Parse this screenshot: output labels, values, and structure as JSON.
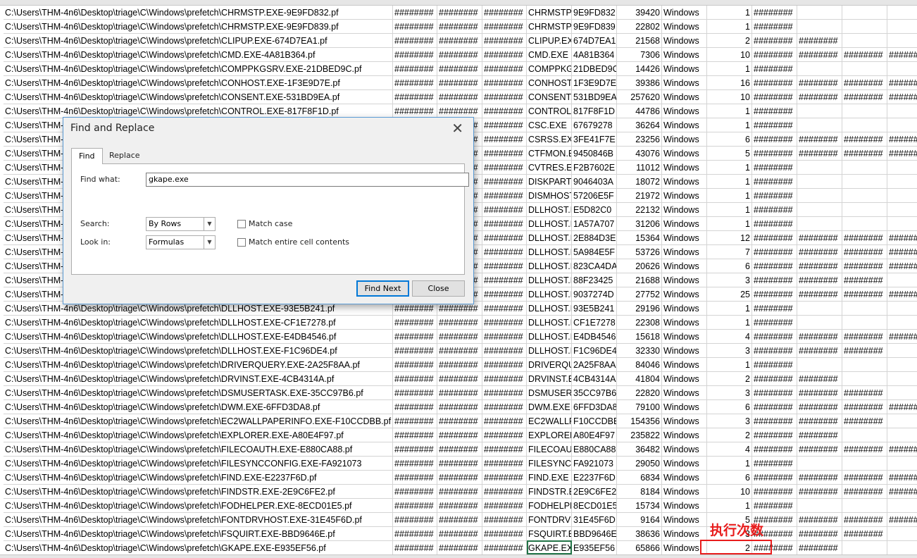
{
  "spreadsheet": {
    "fill": "########",
    "rows": [
      {
        "path": "C:\\Users\\THM-4n6\\Desktop\\triage\\C\\Windows\\prefetch\\CHRMSTP.EXE-9E9FD832.pf",
        "name": "CHRMSTP.",
        "hash": "9E9FD832",
        "size": "39420",
        "os": "Windows",
        "count": "1",
        "extra": 1
      },
      {
        "path": "C:\\Users\\THM-4n6\\Desktop\\triage\\C\\Windows\\prefetch\\CHRMSTP.EXE-9E9FD839.pf",
        "name": "CHRMSTP.",
        "hash": "9E9FD839",
        "size": "22802",
        "os": "Windows",
        "count": "1",
        "extra": 1
      },
      {
        "path": "C:\\Users\\THM-4n6\\Desktop\\triage\\C\\Windows\\prefetch\\CLIPUP.EXE-674D7EA1.pf",
        "name": "CLIPUP.EX",
        "hash": "674D7EA1",
        "size": "21568",
        "os": "Windows",
        "count": "2",
        "extra": 2
      },
      {
        "path": "C:\\Users\\THM-4n6\\Desktop\\triage\\C\\Windows\\prefetch\\CMD.EXE-4A81B364.pf",
        "name": "CMD.EXE",
        "hash": "4A81B364",
        "size": "7306",
        "os": "Windows",
        "count": "10",
        "extra": 4
      },
      {
        "path": "C:\\Users\\THM-4n6\\Desktop\\triage\\C\\Windows\\prefetch\\COMPPKGSRV.EXE-21DBED9C.pf",
        "name": "COMPPKG",
        "hash": "21DBED9C",
        "size": "14426",
        "os": "Windows",
        "count": "1",
        "extra": 1
      },
      {
        "path": "C:\\Users\\THM-4n6\\Desktop\\triage\\C\\Windows\\prefetch\\CONHOST.EXE-1F3E9D7E.pf",
        "name": "CONHOST.",
        "hash": "1F3E9D7E",
        "size": "39386",
        "os": "Windows",
        "count": "16",
        "extra": 4
      },
      {
        "path": "C:\\Users\\THM-4n6\\Desktop\\triage\\C\\Windows\\prefetch\\CONSENT.EXE-531BD9EA.pf",
        "name": "CONSENT.",
        "hash": "531BD9EA",
        "size": "257620",
        "os": "Windows",
        "count": "10",
        "extra": 4
      },
      {
        "path": "C:\\Users\\THM-4n6\\Desktop\\triage\\C\\Windows\\prefetch\\CONTROL.EXE-817F8F1D.pf",
        "name": "CONTROL.",
        "hash": "817F8F1D",
        "size": "44786",
        "os": "Windows",
        "count": "1",
        "extra": 1
      },
      {
        "path": "C:\\Users\\THM-4n6\\Desktop\\triage\\C\\Windows\\prefetch\\CSC.EXE-67679278.pf",
        "name": "CSC.EXE",
        "hash": "67679278",
        "size": "36264",
        "os": "Windows",
        "count": "1",
        "extra": 1
      },
      {
        "path": "C:\\Users\\THM-4n6\\Desktop\\triage\\C\\Windows\\prefetch\\CSRSS.EXE-3FE41F7E.pf",
        "name": "CSRSS.EXE",
        "hash": "3FE41F7E",
        "size": "23256",
        "os": "Windows",
        "count": "6",
        "extra": 4
      },
      {
        "path": "C:\\Users\\THM-4n6\\Desktop\\triage\\C\\Windows\\prefetch\\CTFMON.EXE-9450846B.pf",
        "name": "CTFMON.E",
        "hash": "9450846B",
        "size": "43076",
        "os": "Windows",
        "count": "5",
        "extra": 4
      },
      {
        "path": "C:\\Users\\THM-4n6\\Desktop\\triage\\C\\Windows\\prefetch\\CVTRES.EXE-F2B7602E.pf",
        "name": "CVTRES.EX",
        "hash": "F2B7602E",
        "size": "11012",
        "os": "Windows",
        "count": "1",
        "extra": 1
      },
      {
        "path": "C:\\Users\\THM-4n6\\Desktop\\triage\\C\\Windows\\prefetch\\DISKPART.EXE-9046403A.pf",
        "name": "DISKPART",
        "hash": "9046403A",
        "size": "18072",
        "os": "Windows",
        "count": "1",
        "extra": 1
      },
      {
        "path": "C:\\Users\\THM-4n6\\Desktop\\triage\\C\\Windows\\prefetch\\DISMHOST.EXE-57206E5F.pf",
        "name": "DISMHOST",
        "hash": "57206E5F",
        "size": "21972",
        "os": "Windows",
        "count": "1",
        "extra": 1
      },
      {
        "path": "C:\\Users\\THM-4n6\\Desktop\\triage\\C\\Windows\\prefetch\\DLLHOST.EXE-E5D82C0.pf",
        "name": "DLLHOST.E",
        "hash": "E5D82C0",
        "size": "22132",
        "os": "Windows",
        "count": "1",
        "extra": 1
      },
      {
        "path": "C:\\Users\\THM-4n6\\Desktop\\triage\\C\\Windows\\prefetch\\DLLHOST.EXE-1A57A707.pf",
        "name": "DLLHOST.E",
        "hash": "1A57A707",
        "size": "31206",
        "os": "Windows",
        "count": "1",
        "extra": 1
      },
      {
        "path": "C:\\Users\\THM-4n6\\Desktop\\triage\\C\\Windows\\prefetch\\DLLHOST.EXE-2E884D3E.pf",
        "name": "DLLHOST.E",
        "hash": "2E884D3E",
        "size": "15364",
        "os": "Windows",
        "count": "12",
        "extra": 4
      },
      {
        "path": "C:\\Users\\THM-4n6\\Desktop\\triage\\C\\Windows\\prefetch\\DLLHOST.EXE-5A984E5F.pf",
        "name": "DLLHOST.E",
        "hash": "5A984E5F",
        "size": "53726",
        "os": "Windows",
        "count": "7",
        "extra": 4
      },
      {
        "path": "C:\\Users\\THM-4n6\\Desktop\\triage\\C\\Windows\\prefetch\\DLLHOST.EXE-823CA4DA.pf",
        "name": "DLLHOST.E",
        "hash": "823CA4DA",
        "size": "20626",
        "os": "Windows",
        "count": "6",
        "extra": 4
      },
      {
        "path": "C:\\Users\\THM-4n6\\Desktop\\triage\\C\\Windows\\prefetch\\DLLHOST.EXE-88F23425.pf",
        "name": "DLLHOST.E",
        "hash": "88F23425",
        "size": "21688",
        "os": "Windows",
        "count": "3",
        "extra": 3
      },
      {
        "path": "C:\\Users\\THM-4n6\\Desktop\\triage\\C\\Windows\\prefetch\\DLLHOST.EXE-9037274D.pf",
        "name": "DLLHOST.E",
        "hash": "9037274D",
        "size": "27752",
        "os": "Windows",
        "count": "25",
        "extra": 4
      },
      {
        "path": "C:\\Users\\THM-4n6\\Desktop\\triage\\C\\Windows\\prefetch\\DLLHOST.EXE-93E5B241.pf",
        "name": "DLLHOST.E",
        "hash": "93E5B241",
        "size": "29196",
        "os": "Windows",
        "count": "1",
        "extra": 1
      },
      {
        "path": "C:\\Users\\THM-4n6\\Desktop\\triage\\C\\Windows\\prefetch\\DLLHOST.EXE-CF1E7278.pf",
        "name": "DLLHOST.E",
        "hash": "CF1E7278",
        "size": "22308",
        "os": "Windows",
        "count": "1",
        "extra": 1
      },
      {
        "path": "C:\\Users\\THM-4n6\\Desktop\\triage\\C\\Windows\\prefetch\\DLLHOST.EXE-E4DB4546.pf",
        "name": "DLLHOST.E",
        "hash": "E4DB4546",
        "size": "15618",
        "os": "Windows",
        "count": "4",
        "extra": 4
      },
      {
        "path": "C:\\Users\\THM-4n6\\Desktop\\triage\\C\\Windows\\prefetch\\DLLHOST.EXE-F1C96DE4.pf",
        "name": "DLLHOST.E",
        "hash": "F1C96DE4",
        "size": "32330",
        "os": "Windows",
        "count": "3",
        "extra": 3
      },
      {
        "path": "C:\\Users\\THM-4n6\\Desktop\\triage\\C\\Windows\\prefetch\\DRIVERQUERY.EXE-2A25F8AA.pf",
        "name": "DRIVERQU",
        "hash": "2A25F8AA",
        "size": "84046",
        "os": "Windows",
        "count": "1",
        "extra": 1
      },
      {
        "path": "C:\\Users\\THM-4n6\\Desktop\\triage\\C\\Windows\\prefetch\\DRVINST.EXE-4CB4314A.pf",
        "name": "DRVINST.E",
        "hash": "4CB4314A",
        "size": "41804",
        "os": "Windows",
        "count": "2",
        "extra": 2
      },
      {
        "path": "C:\\Users\\THM-4n6\\Desktop\\triage\\C\\Windows\\prefetch\\DSMUSERTASK.EXE-35CC97B6.pf",
        "name": "DSMUSERT",
        "hash": "35CC97B6",
        "size": "22820",
        "os": "Windows",
        "count": "3",
        "extra": 3
      },
      {
        "path": "C:\\Users\\THM-4n6\\Desktop\\triage\\C\\Windows\\prefetch\\DWM.EXE-6FFD3DA8.pf",
        "name": "DWM.EXE",
        "hash": "6FFD3DA8",
        "size": "79100",
        "os": "Windows",
        "count": "6",
        "extra": 4
      },
      {
        "path": "C:\\Users\\THM-4n6\\Desktop\\triage\\C\\Windows\\prefetch\\EC2WALLPAPERINFO.EXE-F10CCDBB.pf",
        "name": "EC2WALLP",
        "hash": "F10CCDBB",
        "size": "154356",
        "os": "Windows",
        "count": "3",
        "extra": 3
      },
      {
        "path": "C:\\Users\\THM-4n6\\Desktop\\triage\\C\\Windows\\prefetch\\EXPLORER.EXE-A80E4F97.pf",
        "name": "EXPLORER",
        "hash": "A80E4F97",
        "size": "235822",
        "os": "Windows",
        "count": "2",
        "extra": 2
      },
      {
        "path": "C:\\Users\\THM-4n6\\Desktop\\triage\\C\\Windows\\prefetch\\FILECOAUTH.EXE-E880CA88.pf",
        "name": "FILECOAU",
        "hash": "E880CA88",
        "size": "36482",
        "os": "Windows",
        "count": "4",
        "extra": 4
      },
      {
        "path": "C:\\Users\\THM-4n6\\Desktop\\triage\\C\\Windows\\prefetch\\FILESYNCCONFIG.EXE-FA921073",
        "name": "FILESYNC",
        "hash": "FA921073",
        "size": "29050",
        "os": "Windows",
        "count": "1",
        "extra": 1
      },
      {
        "path": "C:\\Users\\THM-4n6\\Desktop\\triage\\C\\Windows\\prefetch\\FIND.EXE-E2237F6D.pf",
        "name": "FIND.EXE",
        "hash": "E2237F6D",
        "size": "6834",
        "os": "Windows",
        "count": "6",
        "extra": 4
      },
      {
        "path": "C:\\Users\\THM-4n6\\Desktop\\triage\\C\\Windows\\prefetch\\FINDSTR.EXE-2E9C6FE2.pf",
        "name": "FINDSTR.E",
        "hash": "2E9C6FE2",
        "size": "8184",
        "os": "Windows",
        "count": "10",
        "extra": 4
      },
      {
        "path": "C:\\Users\\THM-4n6\\Desktop\\triage\\C\\Windows\\prefetch\\FODHELPER.EXE-8ECD01E5.pf",
        "name": "FODHELPE",
        "hash": "8ECD01E5",
        "size": "15734",
        "os": "Windows",
        "count": "1",
        "extra": 1
      },
      {
        "path": "C:\\Users\\THM-4n6\\Desktop\\triage\\C\\Windows\\prefetch\\FONTDRVHOST.EXE-31E45F6D.pf",
        "name": "FONTDRV",
        "hash": "31E45F6D",
        "size": "9164",
        "os": "Windows",
        "count": "5",
        "extra": 4
      },
      {
        "path": "C:\\Users\\THM-4n6\\Desktop\\triage\\C\\Windows\\prefetch\\FSQUIRT.EXE-BBD9646E.pf",
        "name": "FSQUIRT.E",
        "hash": "BBD9646E",
        "size": "38636",
        "os": "Windows",
        "count": "3",
        "extra": 3
      },
      {
        "path": "C:\\Users\\THM-4n6\\Desktop\\triage\\C\\Windows\\prefetch\\GKAPE.EXE-E935EF56.pf",
        "name": "GKAPE.EX",
        "hash": "E935EF56",
        "size": "65866",
        "os": "Windows",
        "count": "2",
        "extra": 2
      }
    ]
  },
  "dialog": {
    "title": "Find and Replace",
    "close_glyph": "✕",
    "tabs": [
      "Find",
      "Replace"
    ],
    "find_what_label": "Find what:",
    "find_what_value": "gkape.exe",
    "search_label": "Search:",
    "search_value": "By Rows",
    "lookin_label": "Look in:",
    "lookin_value": "Formulas",
    "match_case_label": "Match case",
    "match_entire_label": "Match entire cell contents",
    "find_next_label": "Find Next",
    "close_label": "Close"
  },
  "annotation": {
    "label": "执行次数",
    "color": "#e81c1c"
  }
}
